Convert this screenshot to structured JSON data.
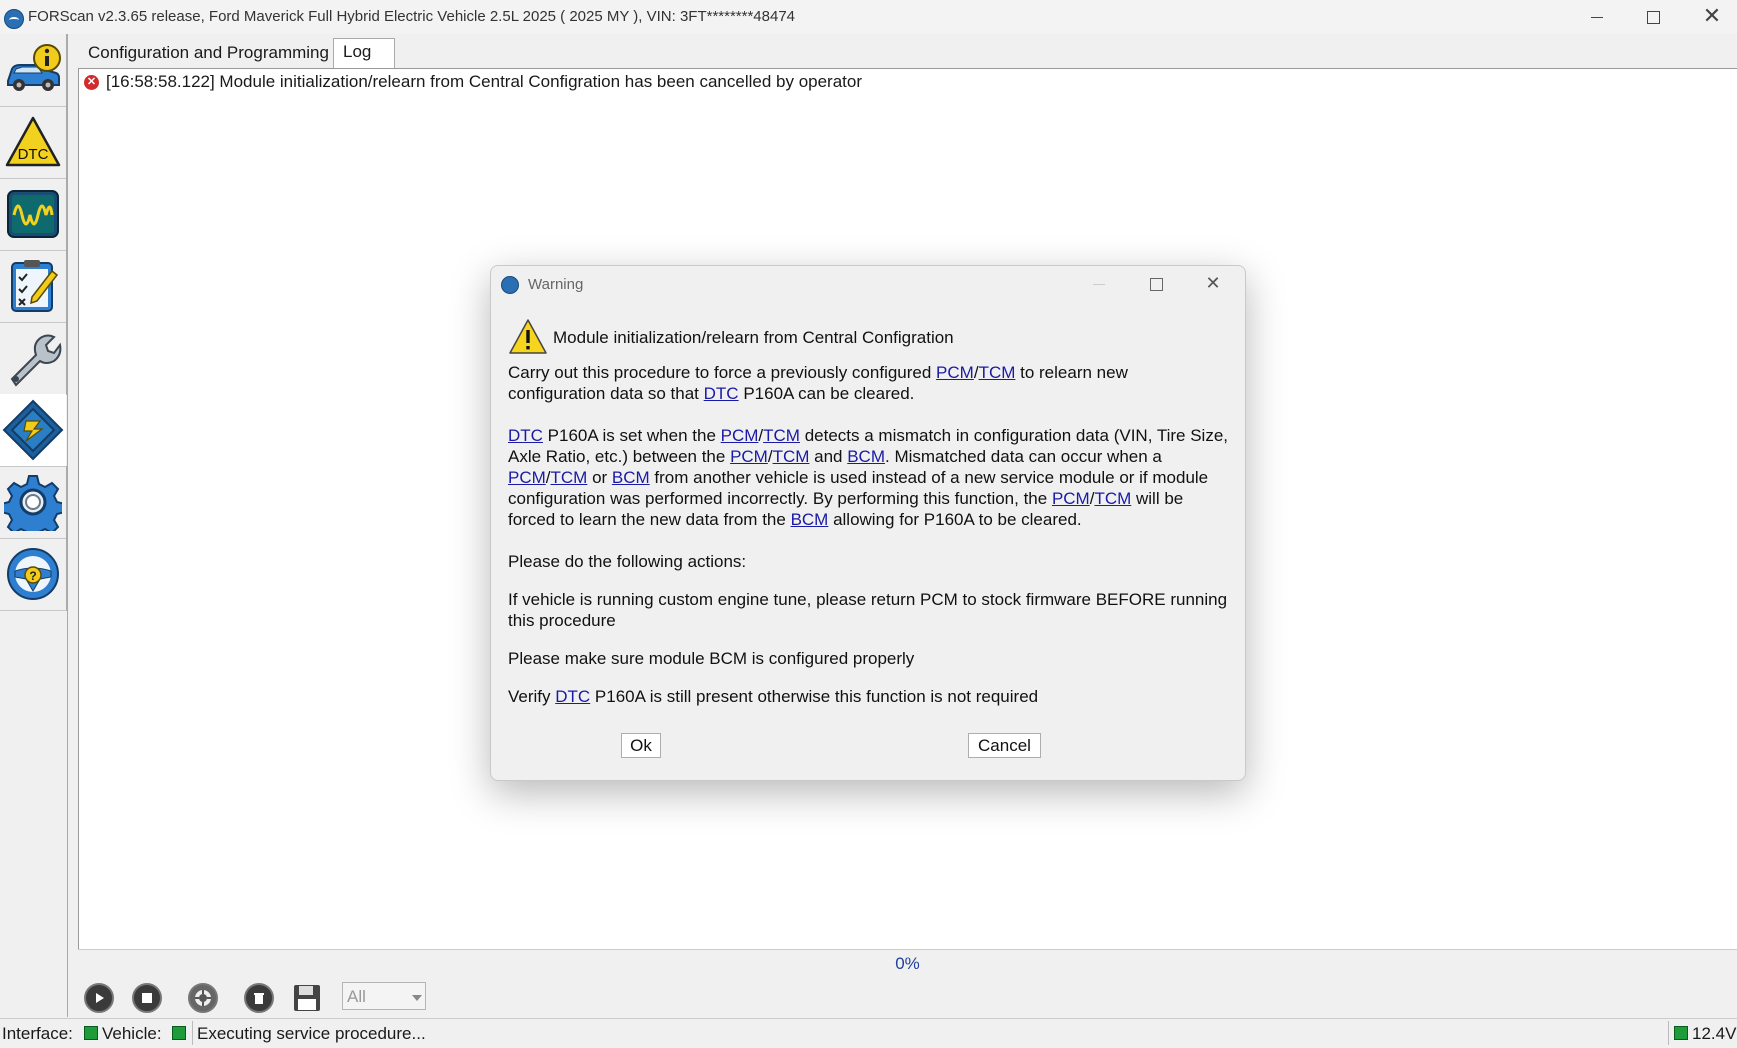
{
  "window": {
    "title": "FORScan v2.3.65 release, Ford Maverick Full Hybrid Electric Vehicle 2.5L 2025 ( 2025 MY ), VIN: 3FT********48474"
  },
  "tabs": {
    "config": "Configuration and Programming",
    "log": "Log"
  },
  "sidebar": {
    "items": [
      "vehicle-info",
      "dtc",
      "oscilloscope",
      "tests",
      "service-functions",
      "configuration-programming",
      "settings",
      "help"
    ],
    "dtc_label": "DTC"
  },
  "log": {
    "entry": "[16:58:58.122] Module initialization/relearn from Central Configration has been cancelled by operator"
  },
  "progress": {
    "percent": 0,
    "label": "0%"
  },
  "toolbar": {
    "filter_value": "All"
  },
  "status": {
    "interface_label": "Interface:",
    "vehicle_label": "Vehicle:",
    "message": "Executing service procedure...",
    "voltage": "12.4V",
    "led_color": "#1e9b3a"
  },
  "dialog": {
    "title": "Warning",
    "heading": "Module initialization/relearn from Central Configration",
    "p1": {
      "a": "Carry out this procedure to force a previously configured ",
      "pcm": "PCM",
      "slash": "/",
      "tcm": "TCM",
      "b": " to relearn new configuration data so that ",
      "dtc": "DTC",
      "c": " P160A can be cleared."
    },
    "p2": {
      "dtc": "DTC",
      "a": " P160A is set when the ",
      "pcm": "PCM",
      "slash": "/",
      "tcm": "TCM",
      "b": " detects a mismatch in configuration data (VIN, Tire Size, Axle Ratio, etc.) between the ",
      "and": " and ",
      "bcm": "BCM",
      "c": ".  Mismatched data can occur when a ",
      "or": " or ",
      "d": " from another vehicle is used instead of a new service module or if module configuration was performed incorrectly.  By performing this function, the ",
      "e": " will be forced to learn the new data from the ",
      "f": " allowing for P160A to be cleared."
    },
    "p3": "Please do the following actions:",
    "p4": "If vehicle is running custom engine tune, please return PCM to stock firmware BEFORE running this procedure",
    "p5": "Please make sure module BCM is configured properly",
    "p6": {
      "a": "Verify ",
      "dtc": "DTC",
      "b": " P160A is still present otherwise this function is not required"
    },
    "ok_label": "Ok",
    "cancel_label": "Cancel"
  }
}
